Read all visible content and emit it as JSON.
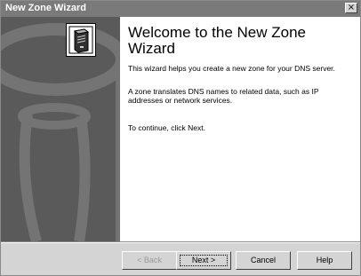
{
  "window": {
    "title": "New Zone Wizard",
    "close_label": "×"
  },
  "sidebar": {
    "icon": "server-icon"
  },
  "content": {
    "heading": "Welcome to the New Zone Wizard",
    "paragraph1": "This wizard helps you create a new zone for your DNS server.",
    "paragraph2": "A zone translates DNS names to related data, such as IP addresses or network services.",
    "paragraph3": "To continue, click Next."
  },
  "buttons": {
    "back": "< Back",
    "next": "Next >",
    "cancel": "Cancel",
    "help": "Help"
  }
}
